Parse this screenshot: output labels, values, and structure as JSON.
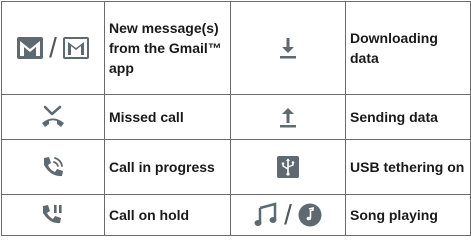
{
  "rows": [
    {
      "left": {
        "icons": [
          "gmail-icon",
          "gmail-outline-icon"
        ],
        "label": "New message(s) from the Gmail™ app"
      },
      "right": {
        "icons": [
          "download-arrow-icon"
        ],
        "label": "Downloading data"
      }
    },
    {
      "left": {
        "icons": [
          "missed-call-icon"
        ],
        "label": "Missed call"
      },
      "right": {
        "icons": [
          "upload-arrow-icon"
        ],
        "label": "Sending data"
      }
    },
    {
      "left": {
        "icons": [
          "call-in-progress-icon"
        ],
        "label": "Call in progress"
      },
      "right": {
        "icons": [
          "usb-tethering-icon"
        ],
        "label": "USB tethering on"
      }
    },
    {
      "left": {
        "icons": [
          "call-on-hold-icon"
        ],
        "label": "Call on hold"
      },
      "right": {
        "icons": [
          "music-note-icon",
          "music-disc-icon"
        ],
        "label": "Song playing"
      }
    }
  ],
  "separator": "/",
  "colors": {
    "icon": "#5f6a70",
    "border": "#6b6b6b",
    "text": "#1a1a1a"
  }
}
